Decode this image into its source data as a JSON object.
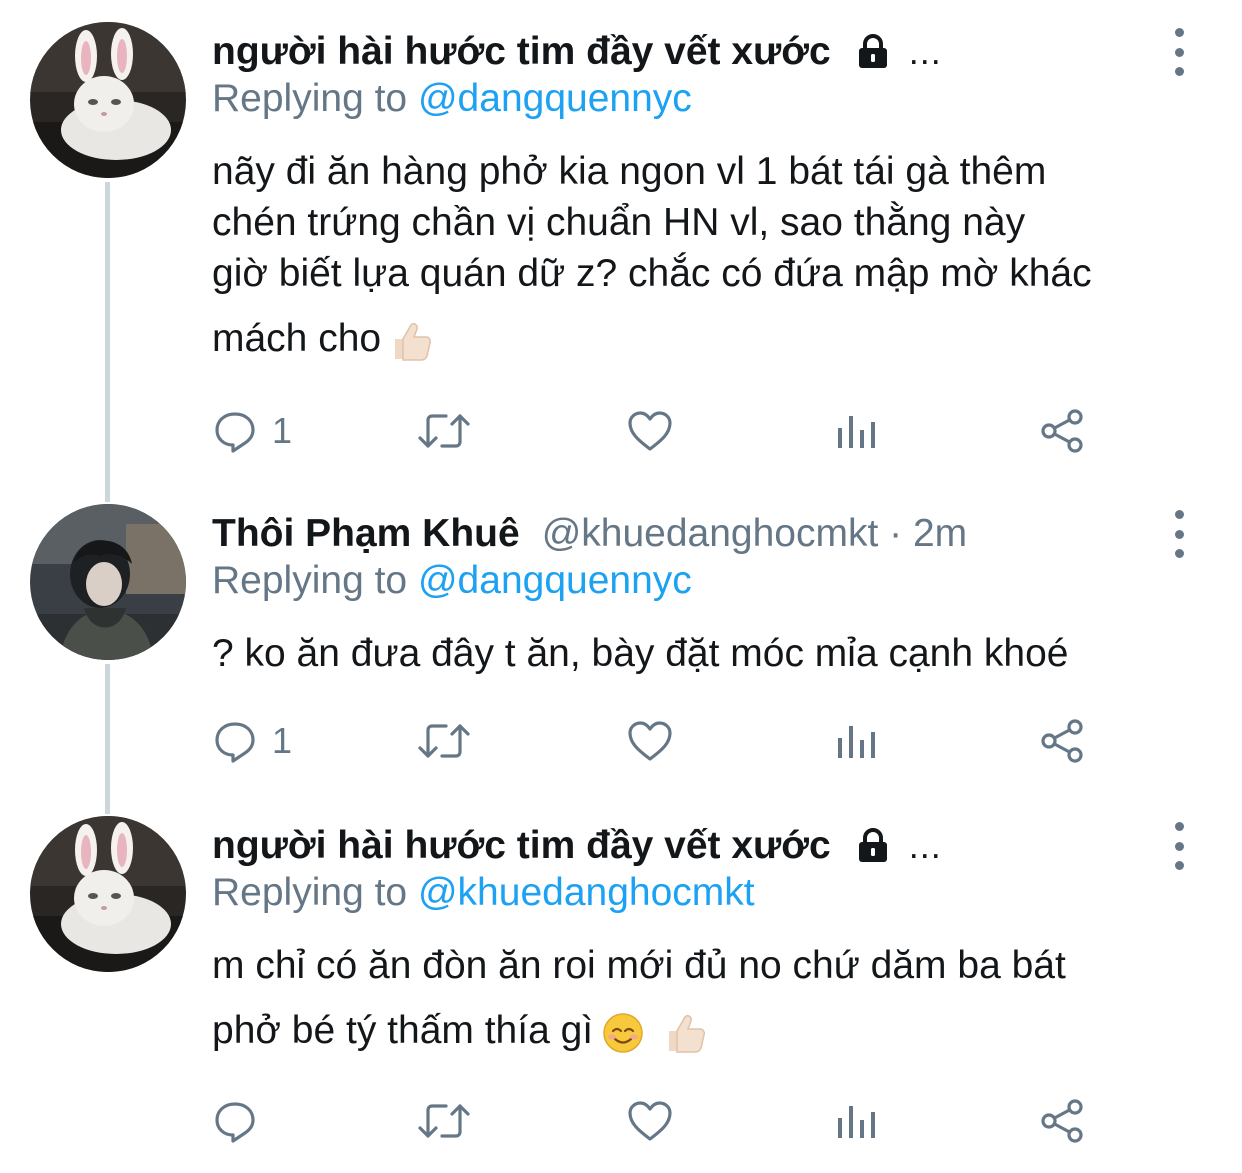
{
  "tweets": [
    {
      "name": "người hài hước tim đầy vết xước",
      "handle_time": "",
      "protected": true,
      "ellipsis": "...",
      "replying_prefix": "Replying to",
      "replying_to": "@dangquennyc",
      "body_lines": [
        "nãy đi ăn hàng phở kia ngon vl 1 bát tái gà thêm",
        "chén trứng chần vị chuẩn HN vl, sao thằng này",
        "giờ biết lựa quán dữ z? chắc có đứa mập mờ khác",
        "mách cho"
      ],
      "trailing_emoji": [
        "thumbs-up"
      ],
      "reply_count": "1"
    },
    {
      "name": "Thôi Phạm Khuê",
      "handle_time": "@khuedanghocmkt · 2m",
      "protected": false,
      "ellipsis": "",
      "replying_prefix": "Replying to",
      "replying_to": "@dangquennyc",
      "body_lines": [
        "? ko ăn đưa đây t ăn, bày đặt móc mỉa cạnh khoé"
      ],
      "trailing_emoji": [],
      "reply_count": "1"
    },
    {
      "name": "người hài hước tim đầy vết xước",
      "handle_time": "",
      "protected": true,
      "ellipsis": "...",
      "replying_prefix": "Replying to",
      "replying_to": "@khuedanghocmkt",
      "body_lines": [
        "m chỉ có ăn đòn ăn roi mới đủ no chứ dăm ba bát",
        "phở bé tý thấm thía gì"
      ],
      "trailing_emoji": [
        "smiling-face",
        "thumbs-up"
      ],
      "reply_count": ""
    }
  ],
  "icons": {
    "reply": "reply-icon",
    "retweet": "retweet-icon",
    "like": "heart-icon",
    "analytics": "analytics-icon",
    "share": "share-icon",
    "more": "more-vertical-icon",
    "lock": "lock-icon"
  },
  "colors": {
    "text": "#14171a",
    "secondary": "#657786",
    "link": "#1da1f2",
    "thread_line": "#ccd6dd"
  }
}
